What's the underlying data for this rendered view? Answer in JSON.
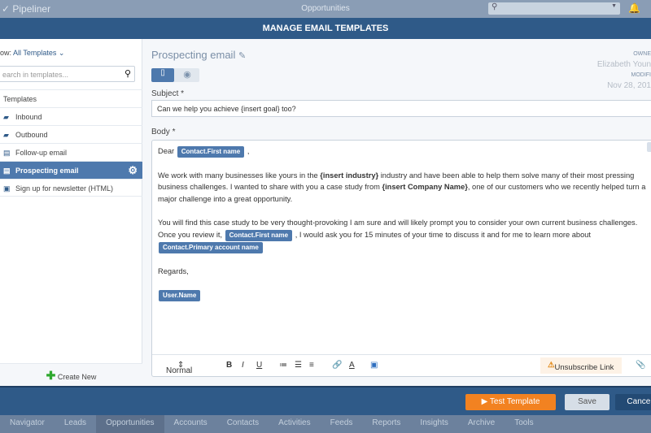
{
  "topbar": {
    "app": "Pipeliner",
    "section": "Opportunities",
    "search_icon": "search-icon",
    "bell_icon": "bell-icon"
  },
  "header": {
    "title": "MANAGE EMAIL TEMPLATES"
  },
  "sidebar": {
    "show_label": "ow:",
    "show_value": "All Templates",
    "search_placeholder": "earch in templates...",
    "items": [
      {
        "label": "Templates",
        "icon": ""
      },
      {
        "label": "Inbound",
        "icon": "folder-icon"
      },
      {
        "label": "Outbound",
        "icon": "folder-icon"
      },
      {
        "label": "Follow-up email",
        "icon": "document-icon"
      },
      {
        "label": "Prospecting email",
        "icon": "document-icon",
        "selected": true
      },
      {
        "label": "Sign up for newsletter (HTML)",
        "icon": "html-icon"
      }
    ],
    "create_new": "Create New"
  },
  "editor": {
    "template_name": "Prospecting email",
    "owner_label": "OWNE",
    "owner": "Elizabeth Youn",
    "modified_label": "MODIFI",
    "modified": "Nov 28, 201",
    "subject_label": "Subject *",
    "subject": "Can we help you achieve {insert goal} too?",
    "body_label": "Body *",
    "body": {
      "greeting": "Dear",
      "tag_first_name": "Contact.First name",
      "comma": ",",
      "p1a": "We work with many businesses like yours in the",
      "p1b": "{insert industry}",
      "p1c": "industry and have been able to help them solve many of their most pressing business challenges. I wanted to share with you a case study from",
      "p1d": "{insert Company Name}",
      "p1e": ", one of our customers who we recently helped turn a major challenge into a great opportunity.",
      "p2a": "You will find this case study to be very thought-provoking I am sure and will likely prompt you to consider your own current business challenges. Once you review it,",
      "p2b": ", I would ask you for 15 minutes of your time to discuss it and for me to learn more about",
      "tag_account": "Contact.Primary account name",
      "regards": "Regards,",
      "tag_user": "User.Name"
    },
    "toolbar": {
      "format": "Normal",
      "bold": "B",
      "italic": "I",
      "underline": "U",
      "unsubscribe": "Unsubscribe Link"
    }
  },
  "footer": {
    "test": "Test Template",
    "save": "Save",
    "cancel": "Cancel"
  },
  "nav": [
    "Navigator",
    "Leads",
    "Opportunities",
    "Accounts",
    "Contacts",
    "Activities",
    "Feeds",
    "Reports",
    "Insights",
    "Archive",
    "Tools"
  ],
  "nav_active": "Opportunities"
}
